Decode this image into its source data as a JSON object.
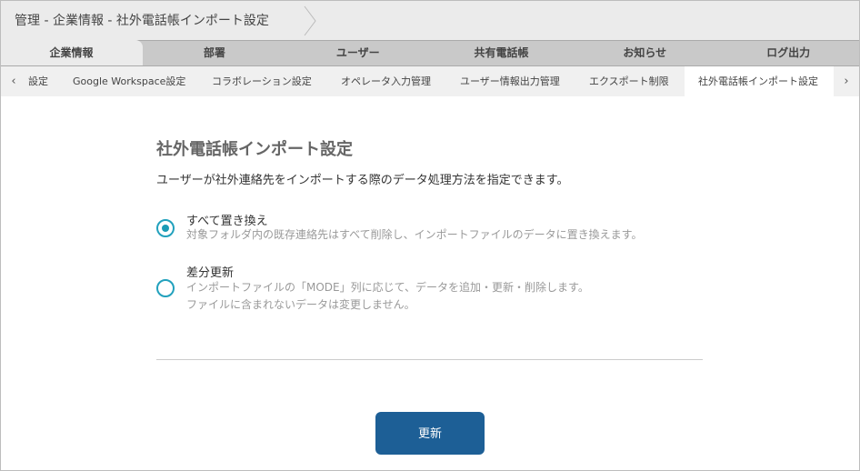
{
  "breadcrumb": "管理 - 企業情報 - 社外電話帳インポート設定",
  "main_tabs": [
    {
      "label": "企業情報",
      "active": true
    },
    {
      "label": "部署"
    },
    {
      "label": "ユーザー"
    },
    {
      "label": "共有電話帳"
    },
    {
      "label": "お知らせ"
    },
    {
      "label": "ログ出力"
    }
  ],
  "sub_tabs": [
    {
      "label": "設定"
    },
    {
      "label": "Google Workspace設定"
    },
    {
      "label": "コラボレーション設定"
    },
    {
      "label": "オペレータ入力管理"
    },
    {
      "label": "ユーザー情報出力管理"
    },
    {
      "label": "エクスポート制限"
    },
    {
      "label": "社外電話帳インポート設定",
      "active": true
    }
  ],
  "page": {
    "title": "社外電話帳インポート設定",
    "description": "ユーザーが社外連絡先をインポートする際のデータ処理方法を指定できます。",
    "options": [
      {
        "title": "すべて置き換え",
        "note1": "対象フォルダ内の既存連絡先はすべて削除し、インポートファイルのデータに置き換えます。",
        "selected": true
      },
      {
        "title": "差分更新",
        "note1": "インポートファイルの「MODE」列に応じて、データを追加・更新・削除します。",
        "note2": "ファイルに含まれないデータは変更しません。",
        "selected": false
      }
    ],
    "submit_label": "更新"
  },
  "colors": {
    "accent": "#1a9bb5",
    "button": "#1d5f96"
  }
}
